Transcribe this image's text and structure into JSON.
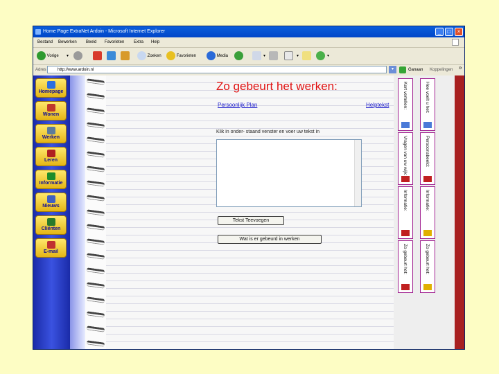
{
  "window": {
    "title": "Home Page ExtraNet Ardoin - Microsoft Internet Explorer",
    "controls": {
      "minimize": "_",
      "maximize": "□",
      "close": "×"
    }
  },
  "menu": [
    "Bestand",
    "Bewerken",
    "Beeld",
    "Favorieten",
    "Extra",
    "Help"
  ],
  "toolbar": {
    "back_label": "Vorige",
    "search_label": "Zoeken",
    "favorites_label": "Favorieten",
    "media_label": "Media",
    "dropdown_glyph": "▾"
  },
  "address": {
    "label": "Adres",
    "value": "http://www.ardoin.nl",
    "go_label": "Ganaan",
    "links_label": "Koppelingen",
    "chevron": "»",
    "dropdown_glyph": "▾"
  },
  "nav": {
    "items": [
      {
        "label": "Homepage",
        "icon": "house-icon",
        "color": "#2b6fe0"
      },
      {
        "label": "Wonen",
        "icon": "house-icon",
        "color": "#c0392b"
      },
      {
        "label": "Werken",
        "icon": "envelope-icon",
        "color": "#5c7c9c"
      },
      {
        "label": "Leren",
        "icon": "person-icon",
        "color": "#b02020"
      },
      {
        "label": "Informatie",
        "icon": "info-icon",
        "color": "#1e8c2a"
      },
      {
        "label": "Nieuws",
        "icon": "newspaper-icon",
        "color": "#4060c0"
      },
      {
        "label": "Cliënten",
        "icon": "group-icon",
        "color": "#2a7a2a"
      },
      {
        "label": "E-mail",
        "icon": "email-icon",
        "color": "#c03030"
      }
    ]
  },
  "main": {
    "heading": "Zo gebeurt het werken:",
    "link_left": "Persoonlijk Plan",
    "link_right": "Helptekst",
    "instruction": "Klik in onder- staand venster en voer uw tekst in",
    "btn_read": "Tekst Teevoegen",
    "btn_work": "Wat is er gebeurd in werken"
  },
  "cards": [
    {
      "label": "Hoe voelt u het:",
      "icon_color": "#4a7ad8"
    },
    {
      "label": "Kort vertellen:",
      "icon_color": "#4a7ad8"
    },
    {
      "label": "Persoonsbeeld:",
      "icon_color": "#c02020"
    },
    {
      "label": "Vragen van uw wijk:",
      "icon_color": "#c02020"
    },
    {
      "label": "Informatie:",
      "icon_color": "#e0b000"
    },
    {
      "label": "Informatie:",
      "icon_color": "#c02020"
    },
    {
      "label": "Zo gebeurt het:",
      "icon_color": "#e0b000"
    },
    {
      "label": "Zo gebeurt het:",
      "icon_color": "#c02020"
    }
  ]
}
